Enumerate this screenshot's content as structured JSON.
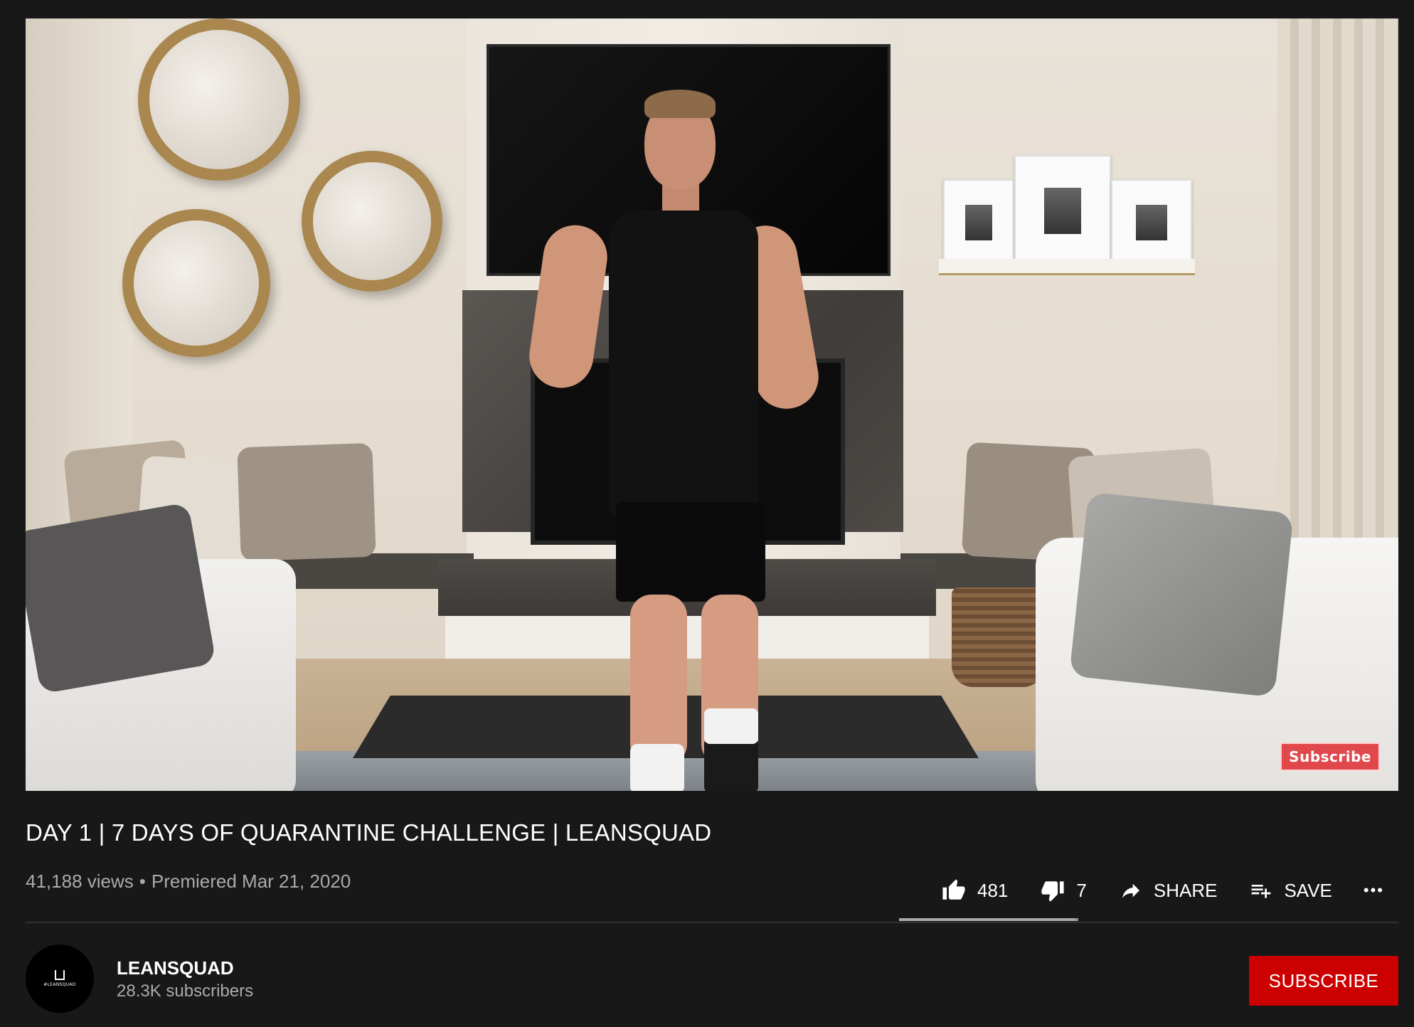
{
  "video": {
    "watermark_label": "Subscribe"
  },
  "title": "DAY 1 | 7 DAYS OF QUARANTINE CHALLENGE | LEANSQUAD",
  "meta": {
    "views": "41,188 views",
    "separator": "•",
    "premiered": "Premiered Mar 21, 2020"
  },
  "actions": {
    "likes": "481",
    "dislikes": "7",
    "share_label": "SHARE",
    "save_label": "SAVE",
    "more_label": "•••",
    "like_ratio": 0.985
  },
  "channel": {
    "name": "LEANSQUAD",
    "subscribers": "28.3K subscribers",
    "avatar_text": "#LEANSQUAD",
    "subscribe_label": "SUBSCRIBE"
  },
  "colors": {
    "background": "#181818",
    "subscribe": "#cc0000",
    "secondary_text": "#aaaaaa"
  }
}
